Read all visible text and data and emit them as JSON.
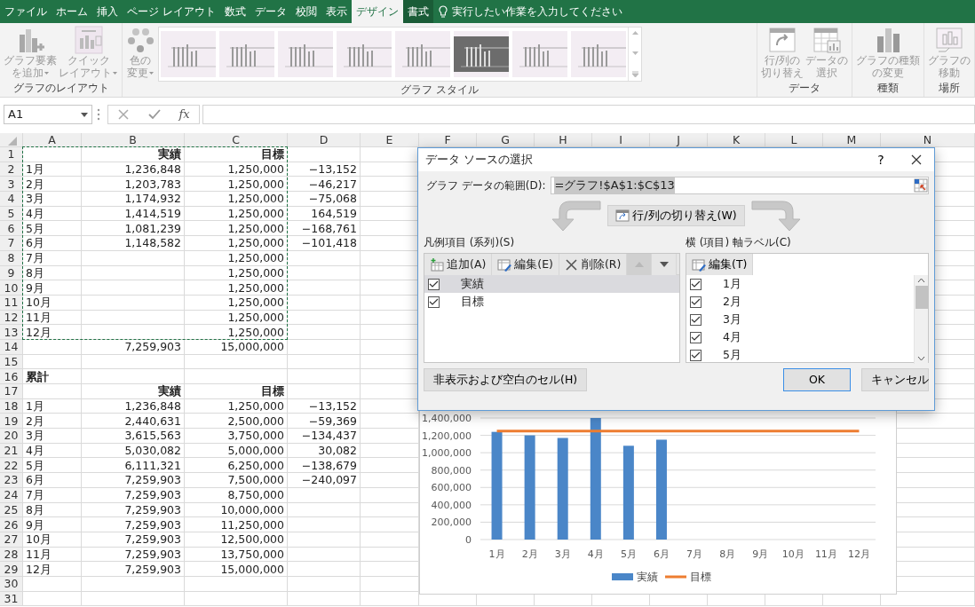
{
  "ribbon_tabs": [
    {
      "label": "ファイル",
      "selected": false,
      "contextual": false
    },
    {
      "label": "ホーム",
      "selected": false,
      "contextual": false
    },
    {
      "label": "挿入",
      "selected": false,
      "contextual": false
    },
    {
      "label": "ページ レイアウト",
      "selected": false,
      "contextual": false
    },
    {
      "label": "数式",
      "selected": false,
      "contextual": false
    },
    {
      "label": "データ",
      "selected": false,
      "contextual": false
    },
    {
      "label": "校閲",
      "selected": false,
      "contextual": false
    },
    {
      "label": "表示",
      "selected": false,
      "contextual": false
    },
    {
      "label": "デザイン",
      "selected": true,
      "contextual": true
    },
    {
      "label": "書式",
      "selected": false,
      "contextual": true
    }
  ],
  "tell_me": {
    "placeholder": "実行したい作業を入力してください"
  },
  "ribbon_groups": [
    {
      "label": "グラフのレイアウト",
      "buttons": [
        {
          "lines": [
            "グラフ要素",
            "を追加"
          ],
          "dropdown": true,
          "disabled": true
        },
        {
          "lines": [
            "クイック",
            "レイアウト"
          ],
          "dropdown": true,
          "disabled": true
        }
      ]
    },
    {
      "label": "グラフ スタイル",
      "buttons": [
        {
          "lines": [
            "色の",
            "変更"
          ],
          "dropdown": true,
          "disabled": true
        }
      ],
      "gallery": [
        {
          "kind": "light"
        },
        {
          "kind": "light"
        },
        {
          "kind": "light"
        },
        {
          "kind": "light"
        },
        {
          "kind": "light"
        },
        {
          "kind": "dark"
        },
        {
          "kind": "light"
        },
        {
          "kind": "light"
        }
      ]
    },
    {
      "label": "データ",
      "buttons": [
        {
          "lines": [
            "行/列の",
            "切り替え"
          ],
          "dropdown": false,
          "disabled": true
        },
        {
          "lines": [
            "データの",
            "選択"
          ],
          "dropdown": false,
          "disabled": true
        }
      ]
    },
    {
      "label": "種類",
      "buttons": [
        {
          "lines": [
            "グラフの種類",
            "の変更"
          ],
          "dropdown": false,
          "disabled": true
        }
      ]
    },
    {
      "label": "場所",
      "buttons": [
        {
          "lines": [
            "グラフの",
            "移動"
          ],
          "dropdown": false,
          "disabled": true
        }
      ]
    }
  ],
  "formula_bar": {
    "name_box": "A1",
    "fx_label": "fx"
  },
  "sheet": {
    "columns": [
      {
        "label": "A"
      },
      {
        "label": "B"
      },
      {
        "label": "C"
      },
      {
        "label": "D"
      },
      {
        "label": "E"
      },
      {
        "label": "F"
      },
      {
        "label": "G"
      },
      {
        "label": "H"
      },
      {
        "label": "I"
      },
      {
        "label": "J"
      },
      {
        "label": "K"
      },
      {
        "label": "L"
      },
      {
        "label": "M"
      },
      {
        "label": "N"
      }
    ],
    "rows": [
      {
        "number": "1",
        "bold": true,
        "cells": [
          null,
          "実績",
          "目標",
          null
        ]
      },
      {
        "number": "2",
        "bold": false,
        "cells": [
          "1月",
          "1,236,848",
          "1,250,000",
          "−13,152"
        ]
      },
      {
        "number": "3",
        "bold": false,
        "cells": [
          "2月",
          "1,203,783",
          "1,250,000",
          "−46,217"
        ]
      },
      {
        "number": "4",
        "bold": false,
        "cells": [
          "3月",
          "1,174,932",
          "1,250,000",
          "−75,068"
        ]
      },
      {
        "number": "5",
        "bold": false,
        "cells": [
          "4月",
          "1,414,519",
          "1,250,000",
          "164,519"
        ]
      },
      {
        "number": "6",
        "bold": false,
        "cells": [
          "5月",
          "1,081,239",
          "1,250,000",
          "−168,761"
        ]
      },
      {
        "number": "7",
        "bold": false,
        "cells": [
          "6月",
          "1,148,582",
          "1,250,000",
          "−101,418"
        ]
      },
      {
        "number": "8",
        "bold": false,
        "cells": [
          "7月",
          null,
          "1,250,000",
          null
        ]
      },
      {
        "number": "9",
        "bold": false,
        "cells": [
          "8月",
          null,
          "1,250,000",
          null
        ]
      },
      {
        "number": "10",
        "bold": false,
        "cells": [
          "9月",
          null,
          "1,250,000",
          null
        ]
      },
      {
        "number": "11",
        "bold": false,
        "cells": [
          "10月",
          null,
          "1,250,000",
          null
        ]
      },
      {
        "number": "12",
        "bold": false,
        "cells": [
          "11月",
          null,
          "1,250,000",
          null
        ]
      },
      {
        "number": "13",
        "bold": false,
        "cells": [
          "12月",
          null,
          "1,250,000",
          null
        ]
      },
      {
        "number": "14",
        "bold": false,
        "cells": [
          null,
          "7,259,903",
          "15,000,000",
          null
        ]
      },
      {
        "number": "15"
      },
      {
        "number": "16",
        "bold": true,
        "cells": [
          "累計",
          null,
          null,
          null
        ]
      },
      {
        "number": "17",
        "bold": true,
        "cells": [
          null,
          "実績",
          "目標",
          null
        ]
      },
      {
        "number": "18",
        "bold": false,
        "cells": [
          "1月",
          "1,236,848",
          "1,250,000",
          "−13,152"
        ]
      },
      {
        "number": "19",
        "bold": false,
        "cells": [
          "2月",
          "2,440,631",
          "2,500,000",
          "−59,369"
        ]
      },
      {
        "number": "20",
        "bold": false,
        "cells": [
          "3月",
          "3,615,563",
          "3,750,000",
          "−134,437"
        ]
      },
      {
        "number": "21",
        "bold": false,
        "cells": [
          "4月",
          "5,030,082",
          "5,000,000",
          "30,082"
        ]
      },
      {
        "number": "22",
        "bold": false,
        "cells": [
          "5月",
          "6,111,321",
          "6,250,000",
          "−138,679"
        ]
      },
      {
        "number": "23",
        "bold": false,
        "cells": [
          "6月",
          "7,259,903",
          "7,500,000",
          "−240,097"
        ]
      },
      {
        "number": "24",
        "bold": false,
        "cells": [
          "7月",
          "7,259,903",
          "8,750,000",
          null
        ]
      },
      {
        "number": "25",
        "bold": false,
        "cells": [
          "8月",
          "7,259,903",
          "10,000,000",
          null
        ]
      },
      {
        "number": "26",
        "bold": false,
        "cells": [
          "9月",
          "7,259,903",
          "11,250,000",
          null
        ]
      },
      {
        "number": "27",
        "bold": false,
        "cells": [
          "10月",
          "7,259,903",
          "12,500,000",
          null
        ]
      },
      {
        "number": "28",
        "bold": false,
        "cells": [
          "11月",
          "7,259,903",
          "13,750,000",
          null
        ]
      },
      {
        "number": "29",
        "bold": false,
        "cells": [
          "12月",
          "7,259,903",
          "15,000,000",
          null
        ]
      },
      {
        "number": "30"
      },
      {
        "number": "31"
      }
    ]
  },
  "chart": {
    "chart_data": {
      "type": "bar",
      "ylim": [
        0,
        1400000
      ],
      "grid": true,
      "legend": "bottom",
      "categories": [
        "1月",
        "2月",
        "3月",
        "4月",
        "5月",
        "6月",
        "7月",
        "8月",
        "9月",
        "10月",
        "11月",
        "12月"
      ],
      "series": [
        {
          "name": "実績",
          "type": "bar",
          "color": "#4a86c8",
          "values": [
            1240000,
            1200000,
            1170000,
            1400000,
            1080000,
            1150000,
            null,
            null,
            null,
            null,
            null,
            null
          ]
        },
        {
          "name": "目標",
          "type": "line",
          "color": "#ed7d31",
          "values": [
            1250000,
            1250000,
            1250000,
            1250000,
            1250000,
            1250000,
            1250000,
            1250000,
            1250000,
            1250000,
            1250000,
            1250000
          ]
        }
      ],
      "yticks": [
        {
          "value": 0,
          "label": "0"
        },
        {
          "value": 200000,
          "label": "200,000"
        },
        {
          "value": 400000,
          "label": "400,000"
        },
        {
          "value": 600000,
          "label": "600,000"
        },
        {
          "value": 800000,
          "label": "800,000"
        },
        {
          "value": 1000000,
          "label": "1,000,000"
        },
        {
          "value": 1200000,
          "label": "1,200,000"
        },
        {
          "value": 1400000,
          "label": "1,400,000"
        }
      ]
    }
  },
  "dialog": {
    "title": "データ ソースの選択",
    "help": "?",
    "range_label": "グラフ データの範囲(D):",
    "range_value": "=グラフ!$A$1:$C$13",
    "switch_button": "行/列の切り替え(W)",
    "series_panel": {
      "label": "凡例項目 (系列)(S)",
      "buttons": [
        {
          "label": "追加(A)",
          "disabled": false
        },
        {
          "label": "編集(E)",
          "disabled": false
        },
        {
          "label": "削除(R)",
          "disabled": false
        }
      ],
      "move_up_disabled": true,
      "items": [
        {
          "label": "実績",
          "checked": true,
          "selected": true
        },
        {
          "label": "目標",
          "checked": true,
          "selected": false
        }
      ]
    },
    "category_panel": {
      "label": "横 (項目) 軸ラベル(C)",
      "edit_button": "編集(T)",
      "items": [
        {
          "label": "1月",
          "checked": true
        },
        {
          "label": "2月",
          "checked": true
        },
        {
          "label": "3月",
          "checked": true
        },
        {
          "label": "4月",
          "checked": true
        },
        {
          "label": "5月",
          "checked": true
        }
      ]
    },
    "hidden_cells_button": "非表示および空白のセル(H)",
    "ok_button": "OK",
    "cancel_button": "キャンセル"
  }
}
